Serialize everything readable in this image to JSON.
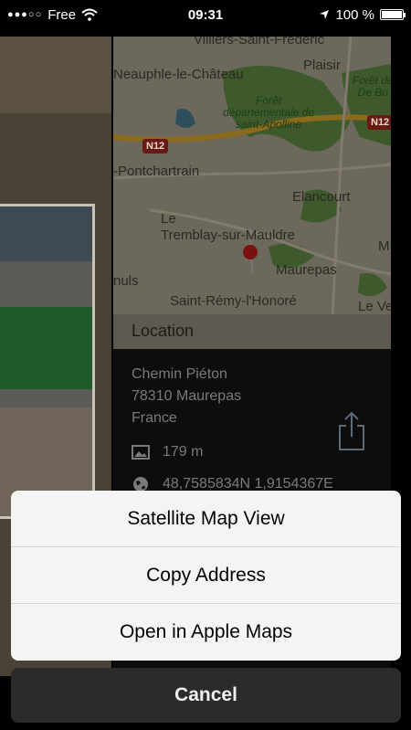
{
  "status_bar": {
    "carrier": "Free",
    "time": "09:31",
    "battery": "100 %",
    "battery_level": 1.0
  },
  "map": {
    "labels": {
      "villiers": "Villiers-Saint-Frédéric",
      "plaisir": "Plaisir",
      "neauphle": "Neauphle-le-Château",
      "foret_sa_1": "Forêt",
      "foret_sa_2": "départementale de",
      "foret_sa_3": "saint-Apolline",
      "foret_bois_1": "Forêt de",
      "foret_bois_2": "De Bo",
      "pontchartrain": "-Pontchartrain",
      "elancourt": "Elancourt",
      "le": "Le",
      "tremblay": "Tremblay-sur-Mauldre",
      "maurepas": "Maurepas",
      "nuls": "nuls",
      "saint_remy": "Saint-Rémy-l'Honoré",
      "le_ve": "Le Ve",
      "m": "M"
    },
    "roads": {
      "n12_left": "N12",
      "n12_right": "N12"
    }
  },
  "location": {
    "header": "Location",
    "address_lines": [
      "Chemin Piéton",
      "78310 Maurepas",
      "France"
    ],
    "altitude": "179 m",
    "coordinates": "48,7585834N 1,9154367E"
  },
  "action_sheet": {
    "items": [
      {
        "label": "Satellite Map View"
      },
      {
        "label": "Copy Address"
      },
      {
        "label": "Open in Apple Maps"
      }
    ],
    "cancel_label": "Cancel"
  }
}
